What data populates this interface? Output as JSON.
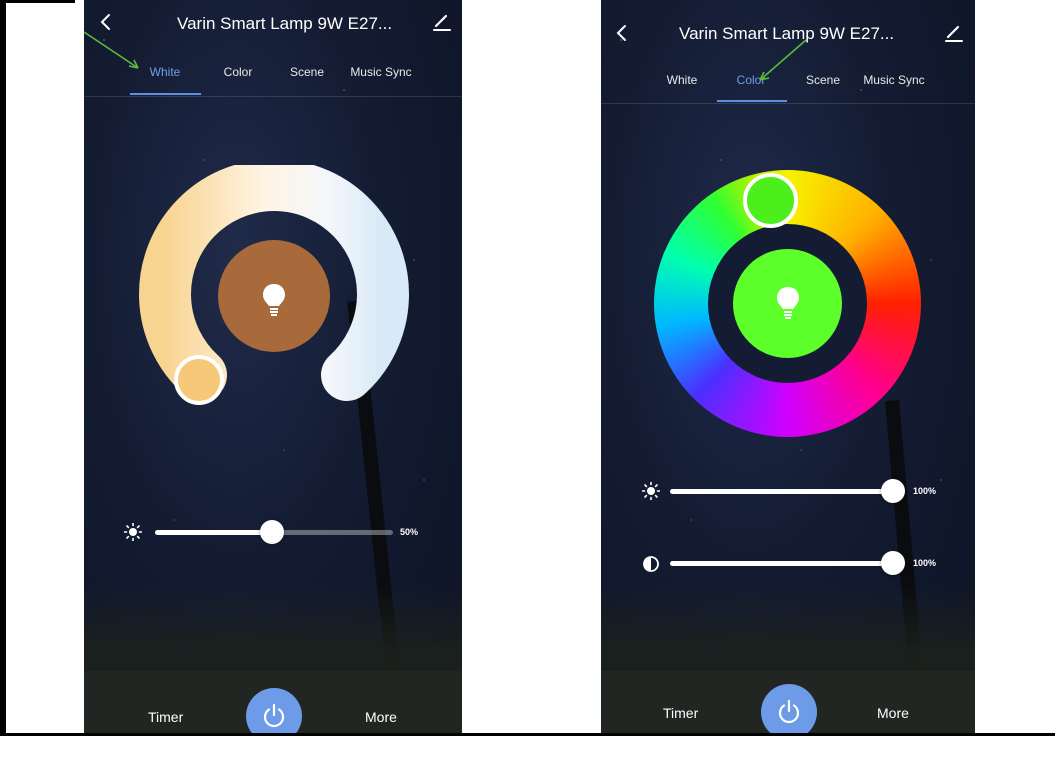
{
  "screens": [
    {
      "title": "Varin Smart Lamp 9W E27...",
      "tabs": [
        "White",
        "Color",
        "Scene",
        "Music Sync"
      ],
      "active_tab": "White",
      "brightness_slider": {
        "value_label": "50%",
        "value": 0.5
      },
      "bottom": {
        "timer_label": "Timer",
        "more_label": "More"
      },
      "colors": {
        "center": "#a86a3a",
        "knob": "#f7c878",
        "accent": "#6d9be8"
      },
      "icons": [
        "back-arrow-icon",
        "edit-pencil-icon",
        "bulb-icon",
        "sun-icon",
        "power-icon"
      ]
    },
    {
      "title": "Varin Smart Lamp 9W E27...",
      "tabs": [
        "White",
        "Color",
        "Scene",
        "Music Sync"
      ],
      "active_tab": "Color",
      "brightness_slider": {
        "value_label": "100%",
        "value": 1.0
      },
      "saturation_slider": {
        "value_label": "100%",
        "value": 1.0
      },
      "bottom": {
        "timer_label": "Timer",
        "more_label": "More"
      },
      "colors": {
        "center": "#5dff2a",
        "accent": "#6d9be8"
      },
      "icons": [
        "back-arrow-icon",
        "edit-pencil-icon",
        "bulb-icon",
        "sun-icon",
        "contrast-icon",
        "power-icon"
      ]
    }
  ],
  "annotations": {
    "arrow_color": "#5dbb3a"
  }
}
